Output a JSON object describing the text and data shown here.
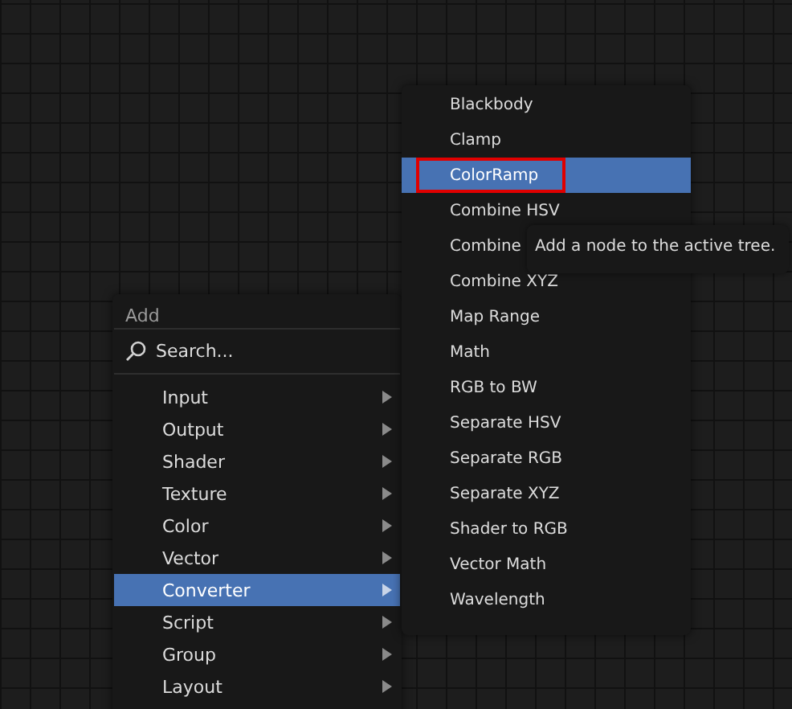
{
  "add_menu": {
    "title": "Add",
    "search": {
      "placeholder": "Search..."
    },
    "items": [
      {
        "label": "Input",
        "selected": false
      },
      {
        "label": "Output",
        "selected": false
      },
      {
        "label": "Shader",
        "selected": false
      },
      {
        "label": "Texture",
        "selected": false
      },
      {
        "label": "Color",
        "selected": false
      },
      {
        "label": "Vector",
        "selected": false
      },
      {
        "label": "Converter",
        "selected": true
      },
      {
        "label": "Script",
        "selected": false
      },
      {
        "label": "Group",
        "selected": false
      },
      {
        "label": "Layout",
        "selected": false
      }
    ]
  },
  "converter_menu": {
    "items": [
      {
        "label": "Blackbody",
        "selected": false
      },
      {
        "label": "Clamp",
        "selected": false
      },
      {
        "label": "ColorRamp",
        "selected": true
      },
      {
        "label": "Combine HSV",
        "selected": false
      },
      {
        "label": "Combine",
        "selected": false
      },
      {
        "label": "Combine XYZ",
        "selected": false
      },
      {
        "label": "Map Range",
        "selected": false
      },
      {
        "label": "Math",
        "selected": false
      },
      {
        "label": "RGB to BW",
        "selected": false
      },
      {
        "label": "Separate HSV",
        "selected": false
      },
      {
        "label": "Separate RGB",
        "selected": false
      },
      {
        "label": "Separate XYZ",
        "selected": false
      },
      {
        "label": "Shader to RGB",
        "selected": false
      },
      {
        "label": "Vector Math",
        "selected": false
      },
      {
        "label": "Wavelength",
        "selected": false
      }
    ]
  },
  "tooltip": {
    "text": "Add a node to the active tree."
  }
}
